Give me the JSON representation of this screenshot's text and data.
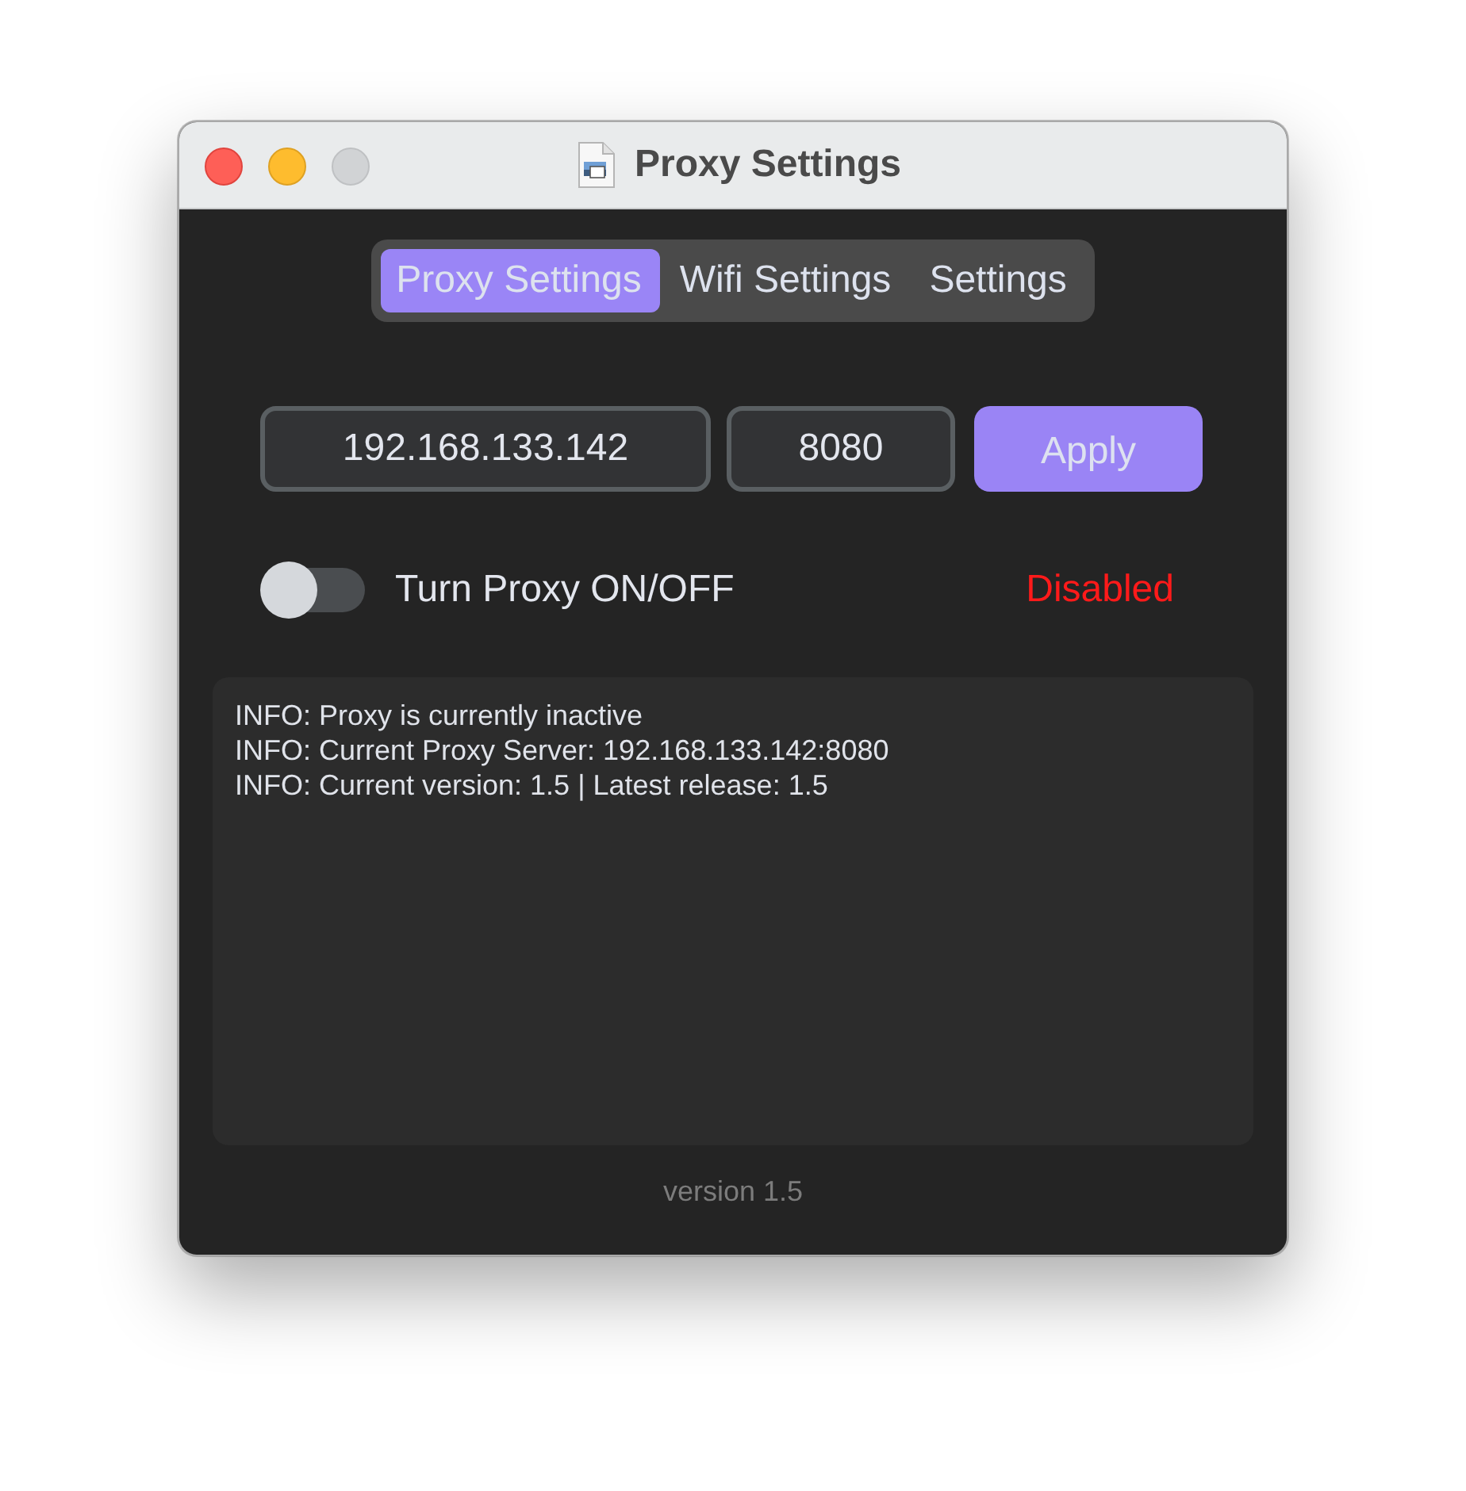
{
  "window": {
    "title": "Proxy Settings"
  },
  "tabs": [
    {
      "label": "Proxy Settings",
      "selected": true
    },
    {
      "label": "Wifi Settings",
      "selected": false
    },
    {
      "label": "Settings",
      "selected": false
    }
  ],
  "proxy": {
    "address": "192.168.133.142",
    "port": "8080",
    "apply_button": "Apply"
  },
  "toggle": {
    "label": "Turn Proxy ON/OFF",
    "on": false,
    "status": "Disabled"
  },
  "log": [
    "INFO: Proxy is currently inactive",
    "INFO: Current Proxy Server: 192.168.133.142:8080",
    "INFO: Current version: 1.5 | Latest release: 1.5"
  ],
  "footer": "version 1.5"
}
